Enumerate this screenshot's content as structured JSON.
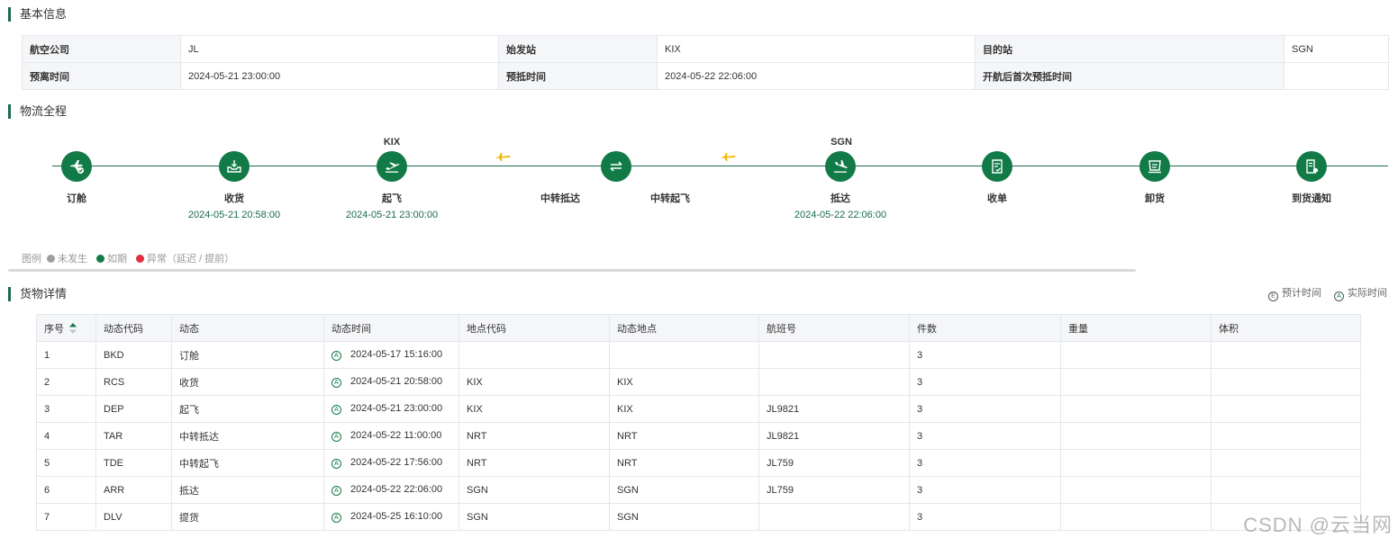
{
  "sections": {
    "basic_info": "基本信息",
    "logistics": "物流全程",
    "cargo_detail": "货物详情"
  },
  "basic_info": {
    "row1": [
      {
        "k": "航空公司",
        "v": "JL"
      },
      {
        "k": "始发站",
        "v": "KIX"
      },
      {
        "k": "目的站",
        "v": "SGN"
      }
    ],
    "row2": [
      {
        "k": "预离时间",
        "v": "2024-05-21 23:00:00"
      },
      {
        "k": "预抵时间",
        "v": "2024-05-22 22:06:00"
      },
      {
        "k": "开航后首次预抵时间",
        "v": ""
      }
    ]
  },
  "timeline": {
    "nodes": [
      {
        "label": "订舱",
        "time": "",
        "code": "",
        "icon": "plane-check-icon"
      },
      {
        "label": "收货",
        "time": "2024-05-21 20:58:00",
        "code": "",
        "icon": "receive-box-icon"
      },
      {
        "label": "起飞",
        "time": "2024-05-21 23:00:00",
        "code": "KIX",
        "icon": "takeoff-icon"
      },
      {
        "label": "中转抵达",
        "time": "",
        "code": "",
        "icon": ""
      },
      {
        "label": "中转起飞",
        "time": "",
        "code": "",
        "icon": "transfer-icon"
      },
      {
        "label": "抵达",
        "time": "2024-05-22 22:06:00",
        "code": "SGN",
        "icon": "landing-icon"
      },
      {
        "label": "收单",
        "time": "",
        "code": "",
        "icon": "document-check-icon"
      },
      {
        "label": "卸货",
        "time": "",
        "code": "",
        "icon": "unload-icon"
      },
      {
        "label": "到货通知",
        "time": "",
        "code": "",
        "icon": "notice-bell-icon"
      }
    ],
    "colors": {
      "done": "#117a47",
      "line": "#1b6b4a",
      "plane_mini": "#f2b705"
    }
  },
  "legend": {
    "title": "图例",
    "items": [
      {
        "label": "未发生",
        "color": "#9e9e9e"
      },
      {
        "label": "如期",
        "color": "#117a47"
      },
      {
        "label": "异常（延迟 / 提前）",
        "color": "#e0303f"
      }
    ]
  },
  "time_legend": {
    "estimated_mark": "E",
    "estimated": "预计时间",
    "actual_mark": "A",
    "actual": "实际时间"
  },
  "detail_table": {
    "headers": [
      "序号",
      "动态代码",
      "动态",
      "动态时间",
      "地点代码",
      "动态地点",
      "航班号",
      "件数",
      "重量",
      "体积"
    ],
    "rows": [
      [
        "1",
        "BKD",
        "订舱",
        "2024-05-17 15:16:00",
        "",
        "",
        "",
        "3",
        "",
        ""
      ],
      [
        "2",
        "RCS",
        "收货",
        "2024-05-21 20:58:00",
        "KIX",
        "KIX",
        "",
        "3",
        "",
        ""
      ],
      [
        "3",
        "DEP",
        "起飞",
        "2024-05-21 23:00:00",
        "KIX",
        "KIX",
        "JL9821",
        "3",
        "",
        ""
      ],
      [
        "4",
        "TAR",
        "中转抵达",
        "2024-05-22 11:00:00",
        "NRT",
        "NRT",
        "JL9821",
        "3",
        "",
        ""
      ],
      [
        "5",
        "TDE",
        "中转起飞",
        "2024-05-22 17:56:00",
        "NRT",
        "NRT",
        "JL759",
        "3",
        "",
        ""
      ],
      [
        "6",
        "ARR",
        "抵达",
        "2024-05-22 22:06:00",
        "SGN",
        "SGN",
        "JL759",
        "3",
        "",
        ""
      ],
      [
        "7",
        "DLV",
        "提货",
        "2024-05-25 16:10:00",
        "SGN",
        "SGN",
        "",
        "3",
        "",
        ""
      ]
    ]
  },
  "watermark": "CSDN @云当网"
}
